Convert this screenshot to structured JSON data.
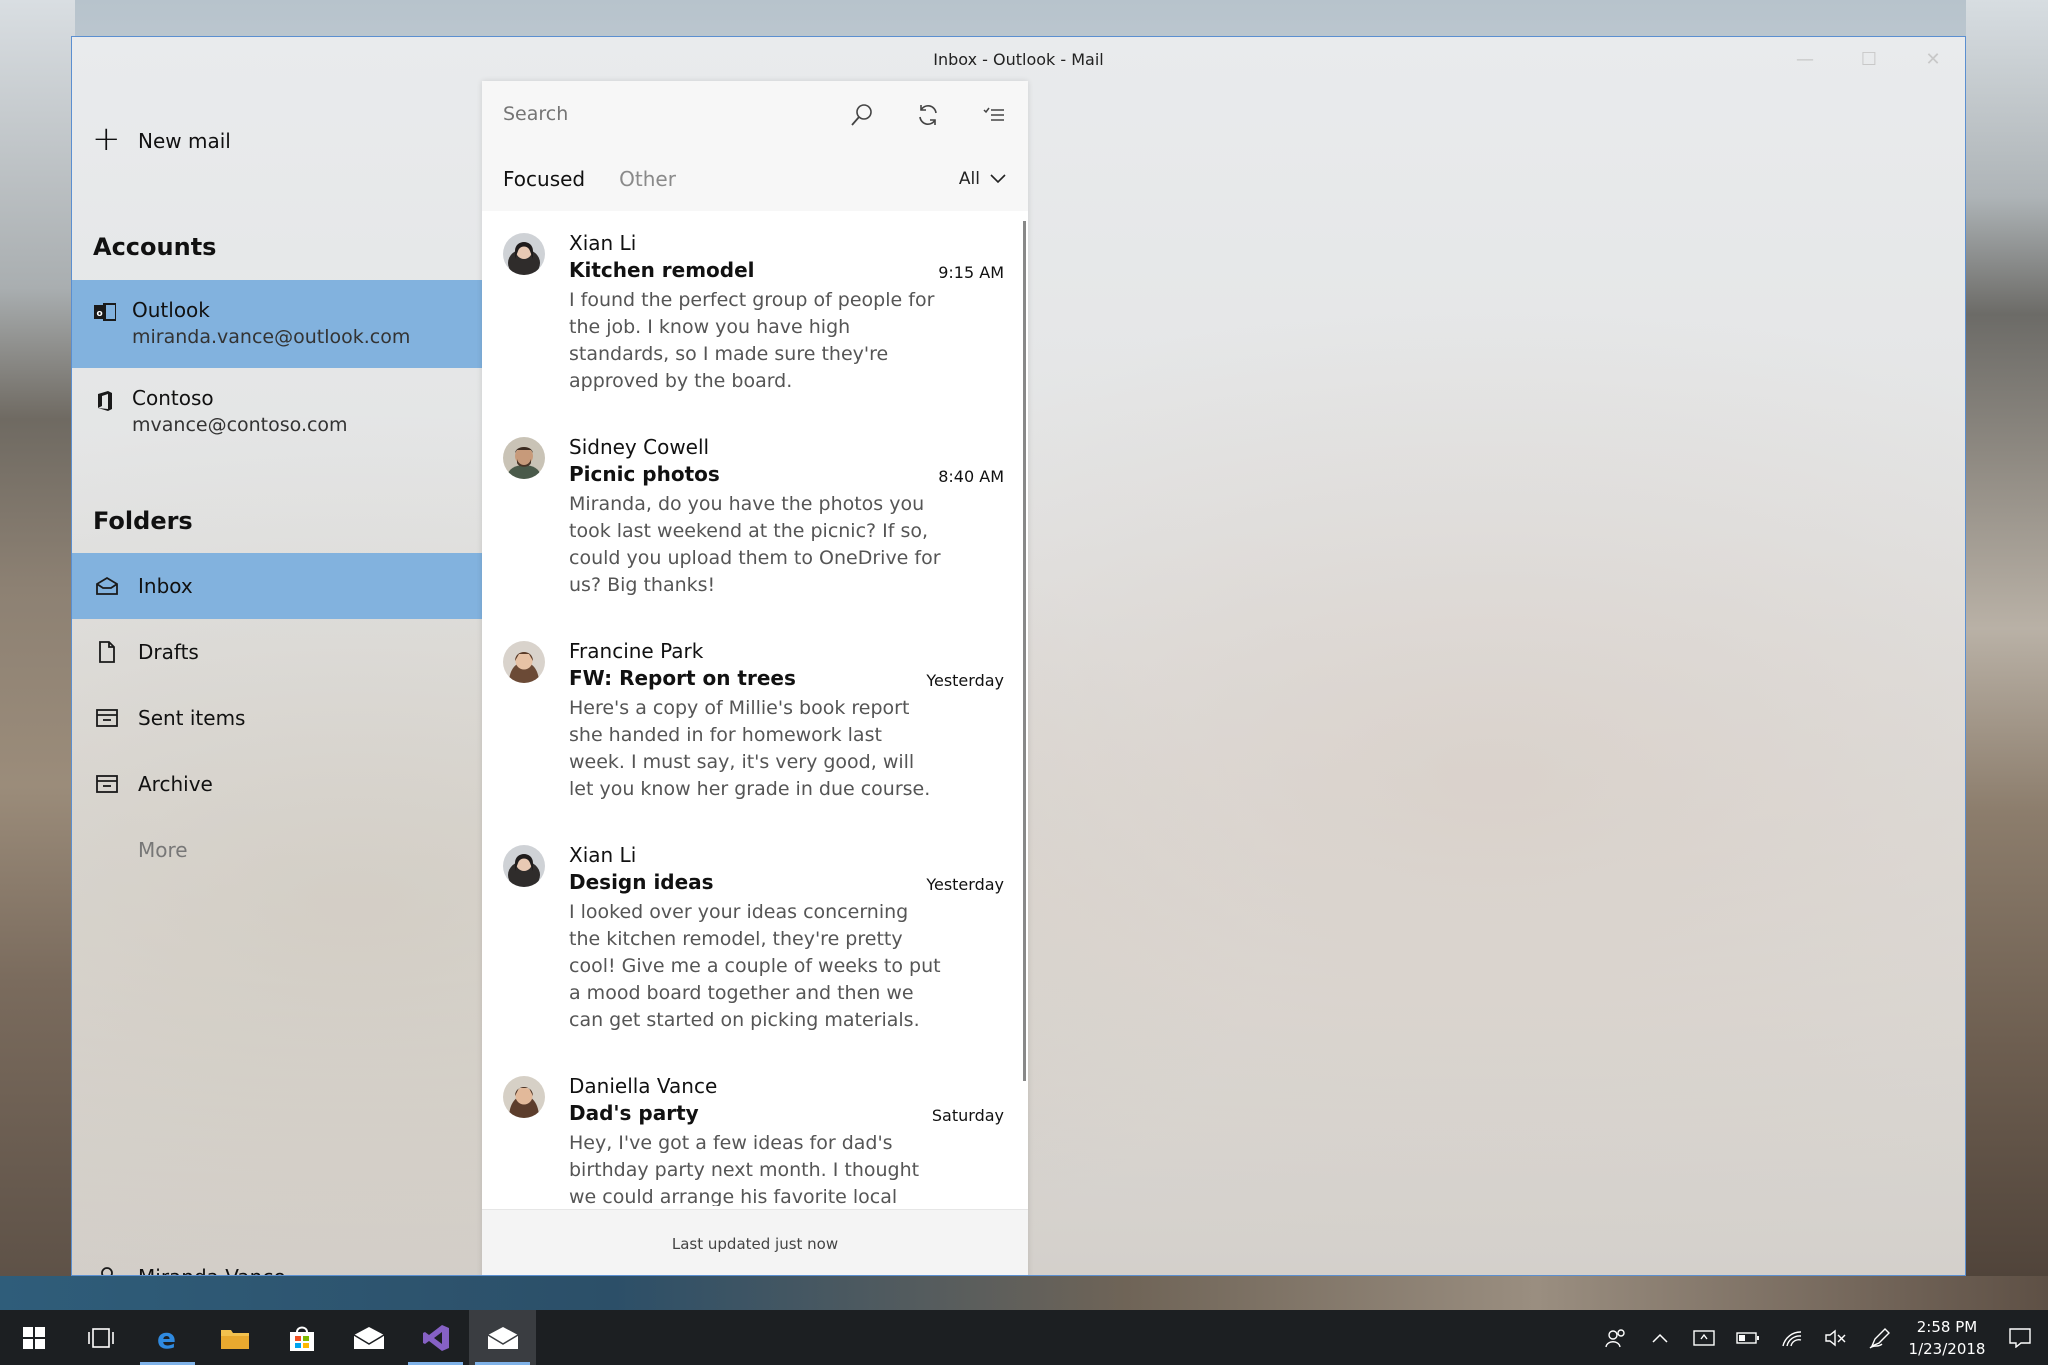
{
  "window": {
    "title": "Inbox - Outlook - Mail",
    "controls": [
      "—",
      "☐",
      "✕"
    ]
  },
  "nav": {
    "new_mail": "New mail",
    "accounts_title": "Accounts",
    "accounts": [
      {
        "name": "Outlook",
        "email": "miranda.vance@outlook.com",
        "icon": "outlook-icon"
      },
      {
        "name": "Contoso",
        "email": "mvance@contoso.com",
        "icon": "office-icon"
      }
    ],
    "folders_title": "Folders",
    "folders": [
      {
        "label": "Inbox",
        "icon": "inbox-icon"
      },
      {
        "label": "Drafts",
        "icon": "draft-icon"
      },
      {
        "label": "Sent items",
        "icon": "sent-icon"
      },
      {
        "label": "Archive",
        "icon": "archive-icon"
      },
      {
        "label": "More"
      }
    ],
    "user": "Miranda Vance"
  },
  "list": {
    "search_placeholder": "Search",
    "tabs": [
      "Focused",
      "Other"
    ],
    "filter": "All",
    "messages": [
      {
        "sender": "Xian Li",
        "subject": "Kitchen remodel",
        "time": "9:15 AM",
        "preview": "I found the perfect group of people for the job. I know you have high standards, so I made sure they're approved by the board.",
        "avatar_color": "#3b3a3a"
      },
      {
        "sender": "Sidney Cowell",
        "subject": "Picnic photos",
        "time": "8:40 AM",
        "preview": "Miranda, do you have the photos you took last weekend at the picnic? If so, could you upload them to OneDrive for us? Big thanks!",
        "avatar_color": "#6b5a47"
      },
      {
        "sender": "Francine Park",
        "subject": "FW: Report on trees",
        "time": "Yesterday",
        "preview": "Here's a copy of Millie's book report she handed in for homework last week. I must say, it's very good, will let you know her grade in due course.",
        "avatar_color": "#7a5a45"
      },
      {
        "sender": "Xian Li",
        "subject": "Design ideas",
        "time": "Yesterday",
        "preview": "I looked over your ideas concerning the kitchen remodel, they're pretty cool! Give me a couple of weeks to put a mood board together and then we can get started on picking materials.",
        "avatar_color": "#3b3a3a"
      },
      {
        "sender": "Daniella Vance",
        "subject": "Dad's party",
        "time": "Saturday",
        "preview": "Hey, I've got a few ideas for dad's birthday party next month. I thought we could arrange his favorite local",
        "avatar_color": "#6d4f3e"
      }
    ],
    "footer": "Last updated just now"
  },
  "taskbar": {
    "time": "2:58 PM",
    "date": "1/23/2018"
  }
}
